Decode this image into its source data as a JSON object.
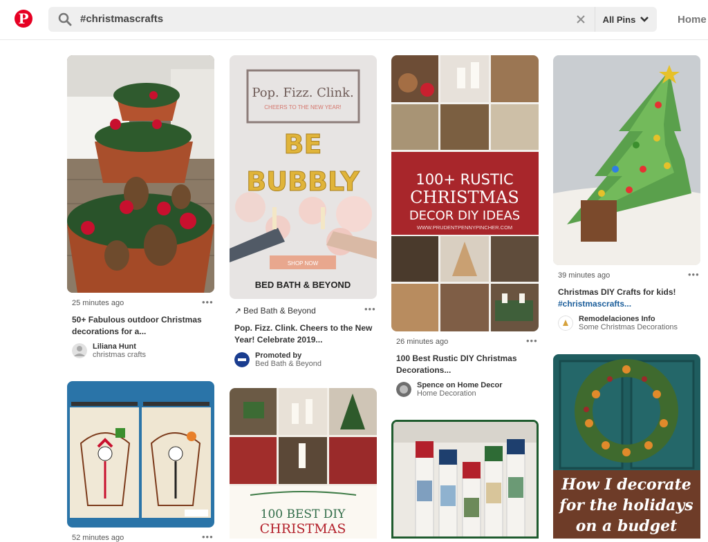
{
  "header": {
    "logo": "P",
    "search_value": "#christmascrafts",
    "filter_label": "All Pins",
    "home_label": "Home"
  },
  "pins": {
    "p1": {
      "time": "25 minutes ago",
      "title": "50+ Fabulous outdoor Christmas decorations for a...",
      "user": "Liliana Hunt",
      "board": "christmas crafts"
    },
    "p2": {
      "source": "Bed Bath & Beyond",
      "title": "Pop. Fizz. Clink. Cheers to the New Year! Celebrate 2019...",
      "promoted": "Promoted by",
      "board": "Bed Bath & Beyond",
      "ad_headline": "Pop. Fizz. Clink.",
      "ad_sub": "CHEERS TO THE NEW YEAR!",
      "ad_b1": "BE",
      "ad_b2": "BUBBLY",
      "ad_btn": "SHOP NOW",
      "ad_brand": "BED BATH & BEYOND"
    },
    "p3": {
      "time": "26 minutes ago",
      "title": "100 Best Rustic DIY Christmas Decorations...",
      "user": "Spence on Home Decor",
      "board": "Home Decoration",
      "banner_1": "100+ RUSTIC",
      "banner_2": "CHRISTMAS",
      "banner_3": "DECOR DIY IDEAS",
      "banner_url": "WWW.PRUDENTPENNYPINCHER.COM"
    },
    "p4": {
      "time": "39 minutes ago",
      "title": "Christmas DIY Crafts for kids!",
      "tag": "#christmascrafts...",
      "user": "Remodelaciones Info",
      "board": "Some Christmas Decorations"
    },
    "p5": {
      "time": "52 minutes ago"
    },
    "p6": {
      "overlay_1": "100 BEST DIY",
      "overlay_2": "CHRISTMAS"
    },
    "p8": {
      "overlay_1": "How I decorate",
      "overlay_2": "for the holidays",
      "overlay_3": "on a budget"
    }
  },
  "colors": {
    "brand": "#e60023",
    "tag": "#1a5d9a"
  },
  "icons": [
    "search-icon",
    "close-icon",
    "chevron-down-icon",
    "more-icon",
    "arrow-icon",
    "avatar"
  ]
}
